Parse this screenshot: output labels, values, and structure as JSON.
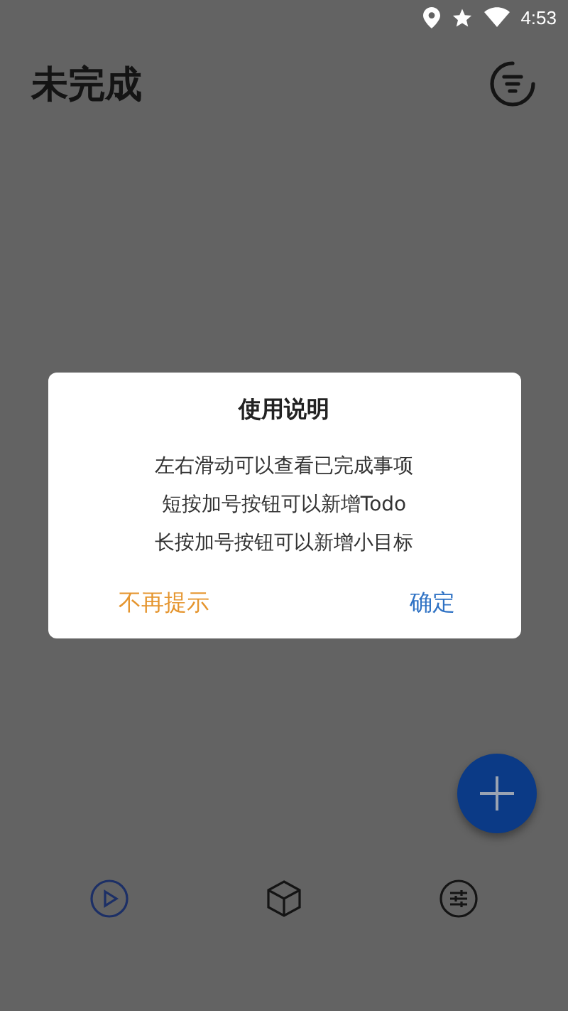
{
  "status_bar": {
    "time": "4:53"
  },
  "header": {
    "title": "未完成"
  },
  "dialog": {
    "title": "使用说明",
    "lines": [
      "左右滑动可以查看已完成事项",
      "短按加号按钮可以新增Todo",
      "长按加号按钮可以新增小目标"
    ],
    "buttons": [
      {
        "label": "不再提示",
        "kind": "dismiss"
      },
      {
        "label": "确定",
        "kind": "confirm"
      }
    ]
  },
  "bottom_nav": [
    {
      "kind": "play",
      "selected": true
    },
    {
      "kind": "cube",
      "selected": false
    },
    {
      "kind": "sliders",
      "selected": false
    }
  ]
}
